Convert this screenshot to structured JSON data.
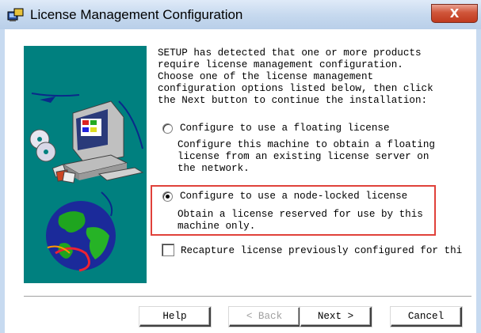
{
  "window": {
    "title": "License Management Configuration",
    "close_glyph": "X",
    "app_icon": "setup-app-icon"
  },
  "intro": {
    "text": "SETUP has detected that one or more products\nrequire license management configuration.\nChoose one of the license management\nconfiguration options listed below, then click\nthe Next button to continue the installation:"
  },
  "options": [
    {
      "label": "Configure to use a floating license",
      "description": "Configure this machine to obtain a floating\nlicense from an existing license server on\nthe network.",
      "selected": false
    },
    {
      "label": "Configure to use a node-locked license",
      "description": "Obtain a license reserved for use by this\nmachine only.",
      "selected": true
    }
  ],
  "recapture": {
    "label": "Recapture license previously configured for thi",
    "checked": false
  },
  "buttons": {
    "help": "Help",
    "back": "< Back",
    "next": "Next >",
    "cancel": "Cancel"
  },
  "colors": {
    "highlight": "#e0413a",
    "art_background": "#00807f",
    "close_button": "#c9452a"
  }
}
